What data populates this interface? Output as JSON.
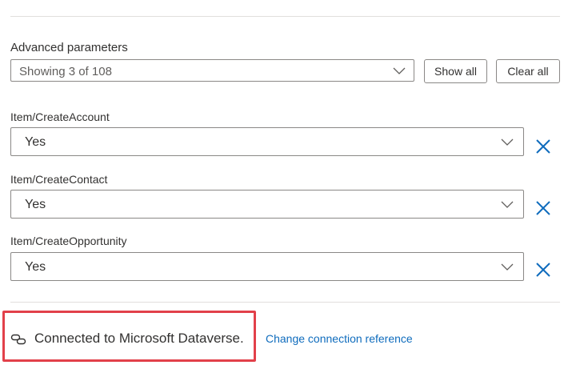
{
  "advanced": {
    "label": "Advanced parameters",
    "select_value": "Showing 3 of 108",
    "show_all_label": "Show all",
    "clear_all_label": "Clear all"
  },
  "params": [
    {
      "label": "Item/CreateAccount",
      "value": "Yes"
    },
    {
      "label": "Item/CreateContact",
      "value": "Yes"
    },
    {
      "label": "Item/CreateOpportunity",
      "value": "Yes"
    }
  ],
  "connection": {
    "status_text": "Connected to Microsoft Dataverse.",
    "change_link_label": "Change connection reference",
    "icon": "link-icon"
  },
  "colors": {
    "accent": "#0f6cbd",
    "highlight": "#e2404a",
    "border": "#8a8886"
  }
}
